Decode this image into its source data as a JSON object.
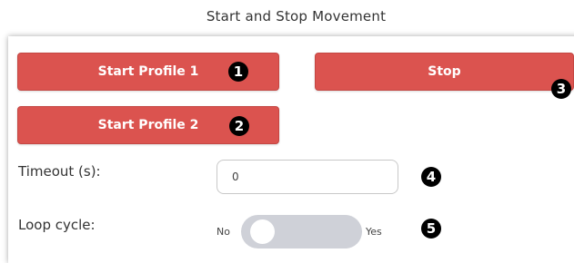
{
  "panel": {
    "title": "Start and Stop Movement"
  },
  "buttons": {
    "start_profile_1": "Start Profile 1",
    "stop": "Stop",
    "start_profile_2": "Start Profile 2"
  },
  "markers": [
    "1",
    "2",
    "3",
    "4",
    "5"
  ],
  "timeout": {
    "label": "Timeout (s):",
    "value": "0"
  },
  "loop_cycle": {
    "label": "Loop cycle:",
    "off_label": "No",
    "on_label": "Yes",
    "state": "No"
  },
  "colors": {
    "button": "#db534f",
    "toggle_track": "#cfd1d8",
    "marker": "#000000"
  }
}
